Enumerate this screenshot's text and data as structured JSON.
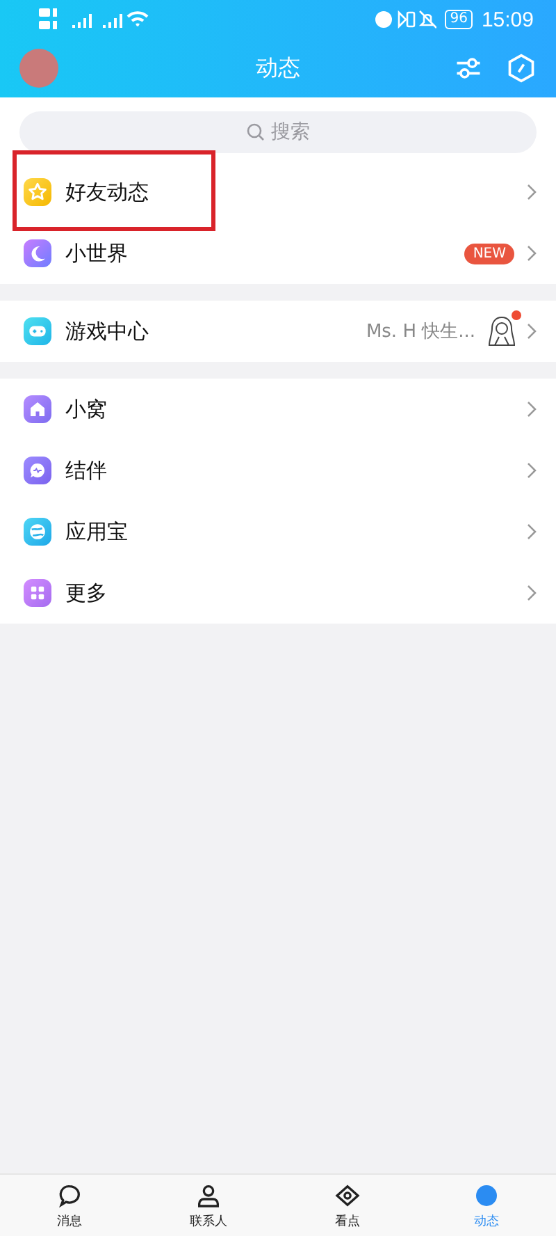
{
  "status_bar": {
    "battery": "96",
    "time": "15:09"
  },
  "header": {
    "title": "动态"
  },
  "search": {
    "placeholder": "搜索"
  },
  "groups": [
    {
      "items": [
        {
          "kind": "star",
          "label": "好友动态",
          "highlighted": true
        },
        {
          "kind": "world",
          "label": "小世界",
          "badge": "NEW",
          "highlighted": false
        }
      ]
    },
    {
      "items": [
        {
          "kind": "game",
          "label": "游戏中心",
          "detail": "Ms. H 快生...",
          "avatar": true,
          "dot": true,
          "highlighted": false
        }
      ]
    },
    {
      "items": [
        {
          "kind": "home",
          "label": "小窝",
          "highlighted": false
        },
        {
          "kind": "partner",
          "label": "结伴",
          "highlighted": false
        },
        {
          "kind": "appstore",
          "label": "应用宝",
          "highlighted": false
        },
        {
          "kind": "more",
          "label": "更多",
          "highlighted": false
        }
      ]
    }
  ],
  "tab_bar": [
    {
      "kind": "messages",
      "label": "消息",
      "selected": false
    },
    {
      "kind": "contacts",
      "label": "联系人",
      "selected": false
    },
    {
      "kind": "watch",
      "label": "看点",
      "selected": false
    },
    {
      "kind": "feed",
      "label": "动态",
      "selected": true
    }
  ]
}
